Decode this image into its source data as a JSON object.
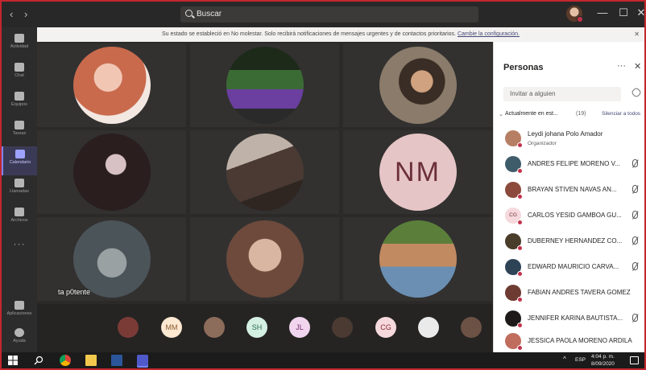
{
  "titlebar": {
    "search_placeholder": "Buscar",
    "back_icon": "chevron-left-icon",
    "forward_icon": "chevron-right-icon",
    "minimize": "—",
    "maximize": "☐",
    "close": "✕"
  },
  "rail": {
    "items": [
      {
        "label": "Actividad",
        "icon": "bell-icon"
      },
      {
        "label": "Chat",
        "icon": "chat-icon"
      },
      {
        "label": "Equipos",
        "icon": "teams-icon"
      },
      {
        "label": "Tareas",
        "icon": "assignments-icon"
      },
      {
        "label": "Calendario",
        "icon": "calendar-icon",
        "active": true
      },
      {
        "label": "Llamadas",
        "icon": "phone-icon"
      },
      {
        "label": "Archivos",
        "icon": "files-icon"
      }
    ],
    "more": "···",
    "bottom": [
      {
        "label": "Aplicaciones",
        "icon": "apps-icon"
      },
      {
        "label": "Ayuda",
        "icon": "help-icon"
      }
    ]
  },
  "banner": {
    "text": "Su estado se estableció en No molestar. Solo recibirá notificaciones de mensajes urgentes y de contactos prioritarios.",
    "link": "Cambie la configuración.",
    "close": "✕"
  },
  "grid": {
    "tiles": [
      {
        "type": "photo",
        "colors": [
          "#c96a4d",
          "#f1c7b4"
        ]
      },
      {
        "type": "photo",
        "colors": [
          "#3b6b34",
          "#6a3fa0"
        ]
      },
      {
        "type": "photo",
        "colors": [
          "#8a7b6a",
          "#3a2d25"
        ]
      },
      {
        "type": "photo",
        "colors": [
          "#2a1e1e",
          "#d7c1c4"
        ]
      },
      {
        "type": "photo",
        "colors": [
          "#bfb2a8",
          "#2f2622"
        ]
      },
      {
        "type": "initials",
        "initials": "NM"
      },
      {
        "type": "photo",
        "colors": [
          "#4b5459",
          "#9aa1a3"
        ],
        "name": "ta p0tente"
      },
      {
        "type": "photo",
        "colors": [
          "#6d4a3c",
          "#d9b6a2"
        ]
      },
      {
        "type": "photo",
        "colors": [
          "#5b7f3a",
          "#c28a61"
        ]
      }
    ]
  },
  "strip": {
    "participants": [
      {
        "type": "photo",
        "color": "#7a3b36"
      },
      {
        "type": "initials",
        "initials": "MM",
        "bg": "#fde8d2",
        "fg": "#8a5a2b"
      },
      {
        "type": "photo",
        "color": "#8c6c5a"
      },
      {
        "type": "initials",
        "initials": "SH",
        "bg": "#d4f0e3",
        "fg": "#2d6a4f"
      },
      {
        "type": "initials",
        "initials": "JL",
        "bg": "#f1d5ee",
        "fg": "#7a2e6d"
      },
      {
        "type": "photo",
        "color": "#4a3a32"
      },
      {
        "type": "initials",
        "initials": "CG",
        "bg": "#f6d9dc",
        "fg": "#8a2a3a"
      },
      {
        "type": "photo",
        "color": "#eaeaea"
      },
      {
        "type": "photo",
        "color": "#6b5244"
      }
    ]
  },
  "panel": {
    "title": "Personas",
    "more": "···",
    "close": "✕",
    "invite_placeholder": "Invitar a alguien",
    "section_label": "Actualmente en est...",
    "section_count": "(19)",
    "mute_all": "Silenciar a todos",
    "people": [
      {
        "name": "Leydi johana Polo Amador",
        "role": "Organizador",
        "avatar_color": "#b67f64",
        "mic": false
      },
      {
        "name": "ANDRES FELIPE MORENO V...",
        "role": "",
        "avatar_color": "#3f5c6a",
        "mic": true
      },
      {
        "name": "BRAYAN STIVEN NAVAS AN...",
        "role": "",
        "avatar_color": "#8b4a3c",
        "mic": true
      },
      {
        "name": "CARLOS YESID GAMBOA GU...",
        "role": "",
        "initials": "CG",
        "avatar_color": "#f6d9dc",
        "mic": true
      },
      {
        "name": "DUBERNEY HERNANDEZ CO...",
        "role": "",
        "avatar_color": "#4a3d2a",
        "mic": true
      },
      {
        "name": "EDWARD MAURICIO CARVA...",
        "role": "",
        "avatar_color": "#2f4357",
        "mic": true
      },
      {
        "name": "FABIAN ANDRES TAVERA GOMEZ",
        "role": "",
        "avatar_color": "#6e3b32",
        "mic": false
      },
      {
        "name": "JENNIFER KARINA BAUTISTA...",
        "role": "",
        "avatar_color": "#1e1a1a",
        "mic": true
      },
      {
        "name": "JESSICA PAOLA MORENO ARDILA",
        "role": "",
        "avatar_color": "#c06d5e",
        "mic": false
      }
    ]
  },
  "taskbar": {
    "lang": "ESP",
    "time": "4:04 p. m.",
    "date": "8/09/2020",
    "caret": "^"
  }
}
